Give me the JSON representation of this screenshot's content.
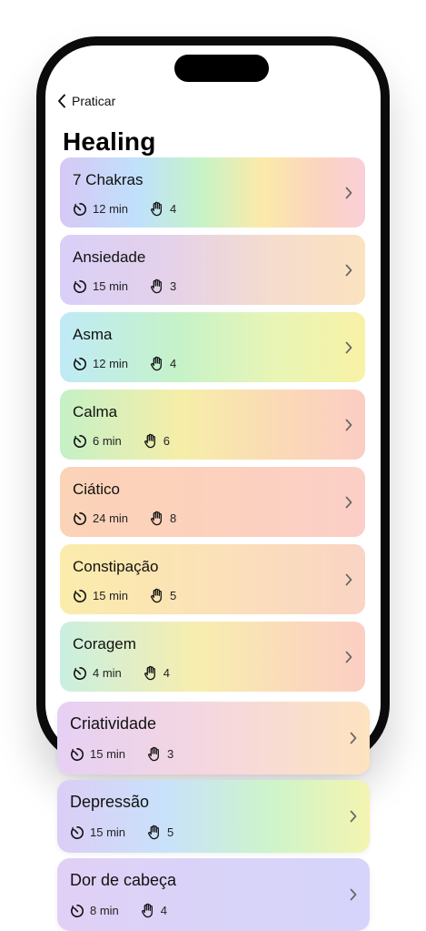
{
  "header": {
    "back_label": "Praticar",
    "title": "Healing"
  },
  "colors": {
    "text": "#111111",
    "phone_frame": "#0b0b0b",
    "background": "#ffffff"
  },
  "items": [
    {
      "name": "7 Chakras",
      "duration": "12 min",
      "hands": "4",
      "gradient": "linear-gradient(90deg,#d7c8f5 0%,#bfe1fb 26%,#c6f3c8 46%,#fbeaa8 66%,#fbd3c2 86%,#f9cfd8 100%)"
    },
    {
      "name": "Ansiedade",
      "duration": "15 min",
      "hands": "3",
      "gradient": "linear-gradient(90deg,#d9cff7 0%,#e4d1ea 35%,#f5dccd 70%,#fbe2bf 100%)"
    },
    {
      "name": "Asma",
      "duration": "12 min",
      "hands": "4",
      "gradient": "linear-gradient(90deg,#bfeaf7 0%,#c5f2c9 38%,#e8f5b6 70%,#f8f2a6 100%)"
    },
    {
      "name": "Calma",
      "duration": "6 min",
      "hands": "6",
      "gradient": "linear-gradient(90deg,#c5f0c6 0%,#f6eea8 40%,#fbd8b7 75%,#fbcdc5 100%)"
    },
    {
      "name": "Ciático",
      "duration": "24 min",
      "hands": "8",
      "gradient": "linear-gradient(90deg,#fbd3b7 0%,#fcd1bd 50%,#fbcfc7 100%)"
    },
    {
      "name": "Constipação",
      "duration": "15 min",
      "hands": "5",
      "gradient": "linear-gradient(90deg,#fbecab 0%,#fbe1b8 50%,#fad4c4 100%)"
    },
    {
      "name": "Coragem",
      "duration": "4 min",
      "hands": "4",
      "gradient": "linear-gradient(90deg,#c9efe0 0%,#f7eeae 45%,#fbd9bb 78%,#fbcfc4 100%)"
    },
    {
      "name": "Criatividade",
      "duration": "15 min",
      "hands": "3",
      "gradient": "linear-gradient(90deg,#e6d0f4 0%,#f5d7df 50%,#fde3bf 100%)"
    },
    {
      "name": "Depressão",
      "duration": "15 min",
      "hands": "5",
      "gradient": "linear-gradient(90deg,#dccdf6 0%,#c8e2fa 35%,#cdf4cb 68%,#f4f4b0 100%)"
    },
    {
      "name": "Dor de cabeça",
      "duration": "8 min",
      "hands": "4",
      "gradient": "linear-gradient(90deg,#e1d0f6 0%,#d9d3f8 50%,#d6d4fa 100%)"
    }
  ]
}
